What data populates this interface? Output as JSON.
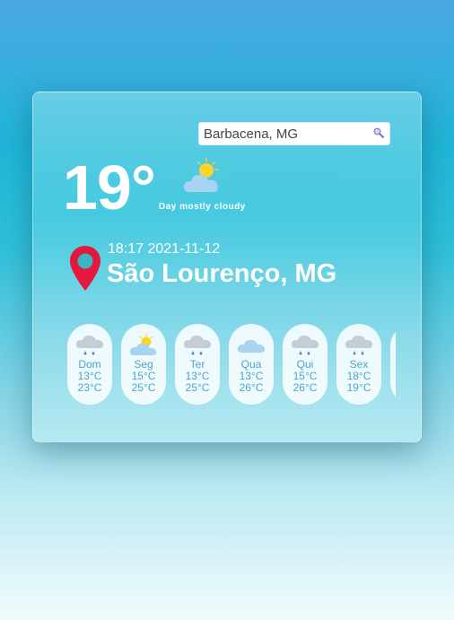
{
  "search": {
    "value": "Barbacena, MG"
  },
  "current": {
    "temperature": "19°",
    "condition": "Day mostly cloudy",
    "condition_icon": "sun-cloud-icon"
  },
  "location": {
    "datetime": "18:17 2021-11-12",
    "city": "São Lourenço, MG",
    "pin_icon": "location-pin-icon"
  },
  "forecast": [
    {
      "day": "Dom",
      "min": "13°C",
      "max": "23°C",
      "icon": "rain-cloud-icon"
    },
    {
      "day": "Seg",
      "min": "15°C",
      "max": "25°C",
      "icon": "sun-cloud-icon"
    },
    {
      "day": "Ter",
      "min": "13°C",
      "max": "25°C",
      "icon": "rain-cloud-icon"
    },
    {
      "day": "Qua",
      "min": "13°C",
      "max": "26°C",
      "icon": "cloud-icon"
    },
    {
      "day": "Qui",
      "min": "15°C",
      "max": "26°C",
      "icon": "rain-cloud-icon"
    },
    {
      "day": "Sex",
      "min": "18°C",
      "max": "19°C",
      "icon": "rain-cloud-icon"
    },
    {
      "day": "",
      "min": "",
      "max": "",
      "icon": ""
    }
  ],
  "colors": {
    "accent_text": "#4da3cf",
    "pin_red": "#e4173d",
    "pin_teal": "#39b8c3",
    "sun_yellow": "#fcd42c",
    "cloud_blue": "#a7d4f3",
    "rain_cloud_gray": "#c6cdd4"
  }
}
